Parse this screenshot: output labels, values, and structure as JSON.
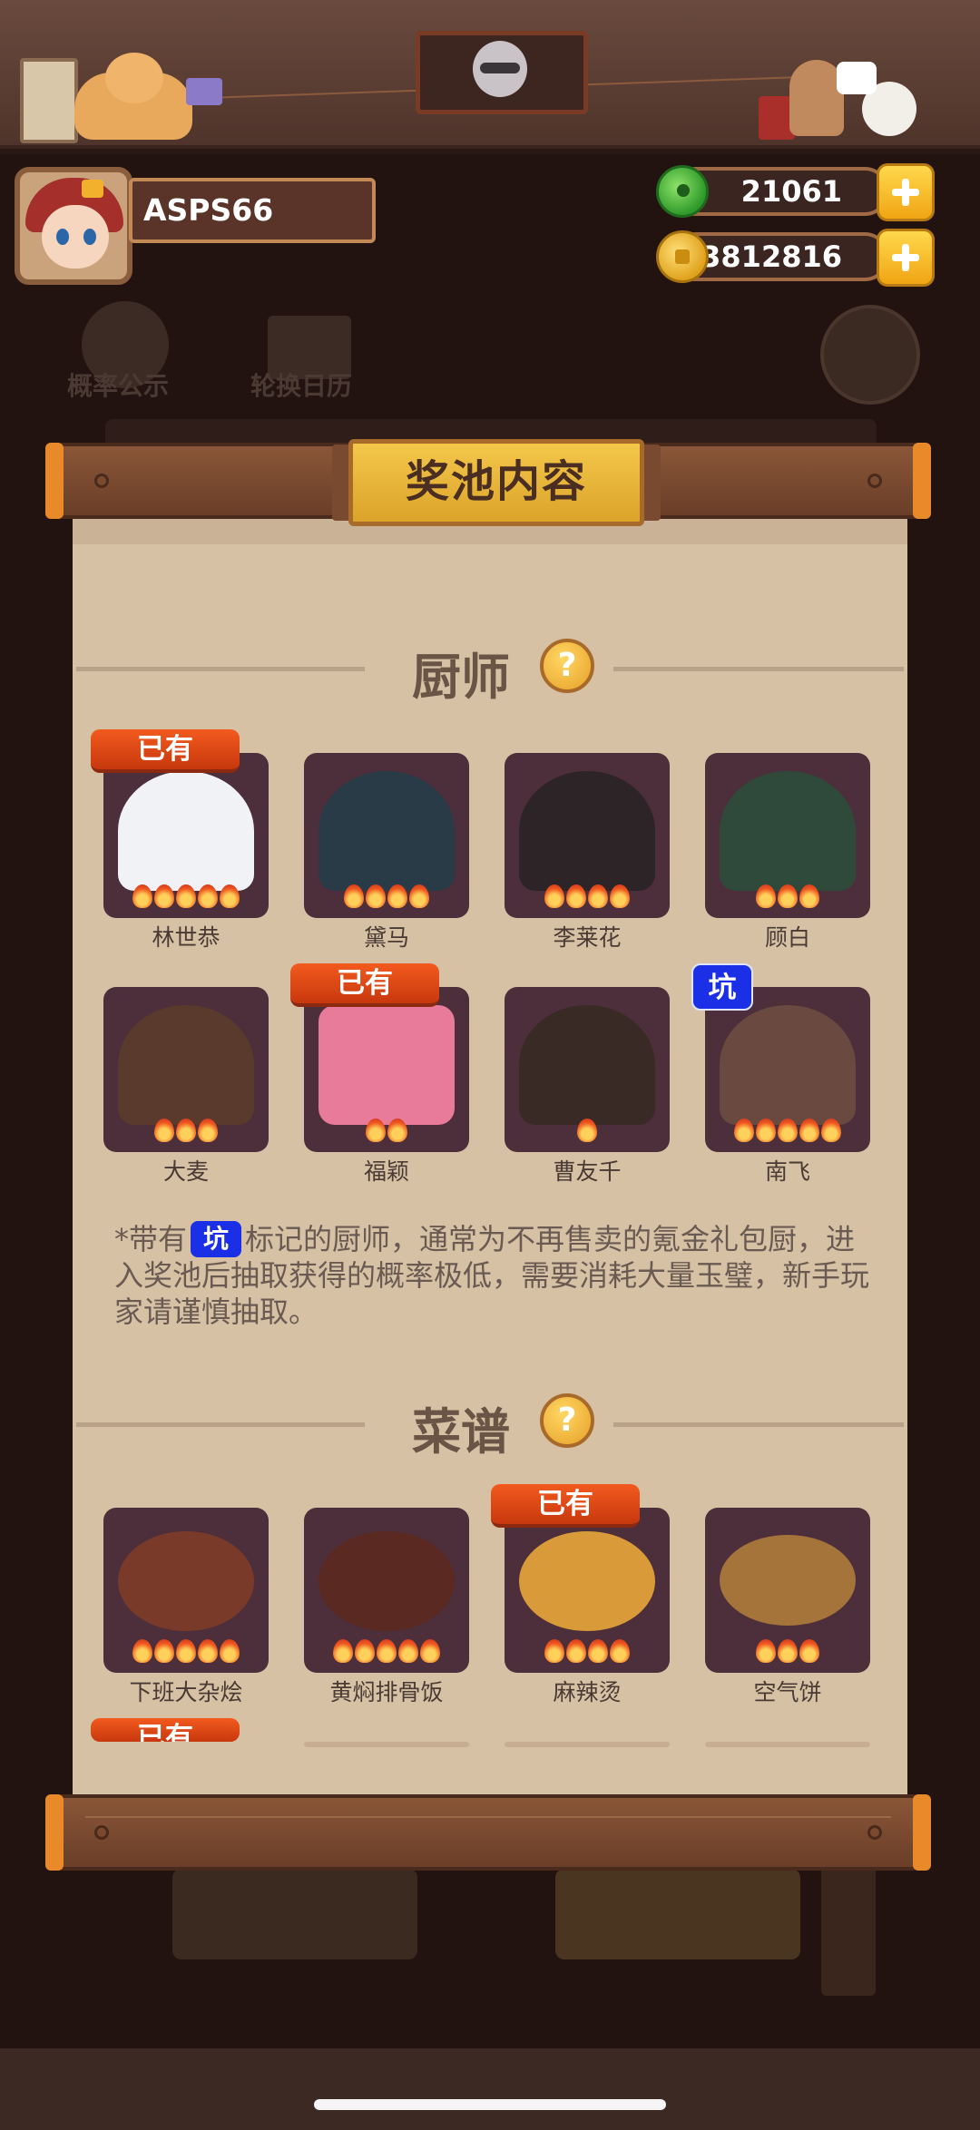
{
  "player": {
    "name": "ASPS66"
  },
  "currency": {
    "jade": "21061",
    "coins": "13812816"
  },
  "background": {
    "probability_label": "概率公示",
    "calendar_label": "轮换日历"
  },
  "modal": {
    "title": "奖池内容",
    "chef_section": {
      "title": "厨师",
      "chefs": [
        {
          "name": "林世恭",
          "stars": 5,
          "owned_label": "已有"
        },
        {
          "name": "黛马",
          "stars": 4
        },
        {
          "name": "李莱花",
          "stars": 4
        },
        {
          "name": "顾白",
          "stars": 3
        },
        {
          "name": "大麦",
          "stars": 3
        },
        {
          "name": "福颖",
          "stars": 2,
          "owned_label": "已有"
        },
        {
          "name": "曹友千",
          "stars": 1
        },
        {
          "name": "南飞",
          "stars": 5,
          "pit_label": "坑"
        }
      ],
      "note": {
        "prefix": "*带有",
        "pit": "坑",
        "suffix": "标记的厨师，通常为不再售卖的氪金礼包厨，进入奖池后抽取获得的概率极低，需要消耗大量玉璧，新手玩家请谨慎抽取。"
      }
    },
    "recipe_section": {
      "title": "菜谱",
      "recipes": [
        {
          "name": "下班大杂烩",
          "stars": 5
        },
        {
          "name": "黄焖排骨饭",
          "stars": 5
        },
        {
          "name": "麻辣烫",
          "stars": 4,
          "owned_label": "已有"
        },
        {
          "name": "空气饼",
          "stars": 3
        }
      ],
      "next_row_owned_label": "已有"
    }
  },
  "colors": {
    "owned_badge": "#e2471a",
    "pit_badge": "#1a2fe6",
    "card_bg": "#4c2f3a",
    "paper": "#d7c1a5"
  },
  "icons": [
    "jade-icon",
    "coin-icon",
    "plus-icon",
    "question-icon",
    "flame-icon"
  ]
}
